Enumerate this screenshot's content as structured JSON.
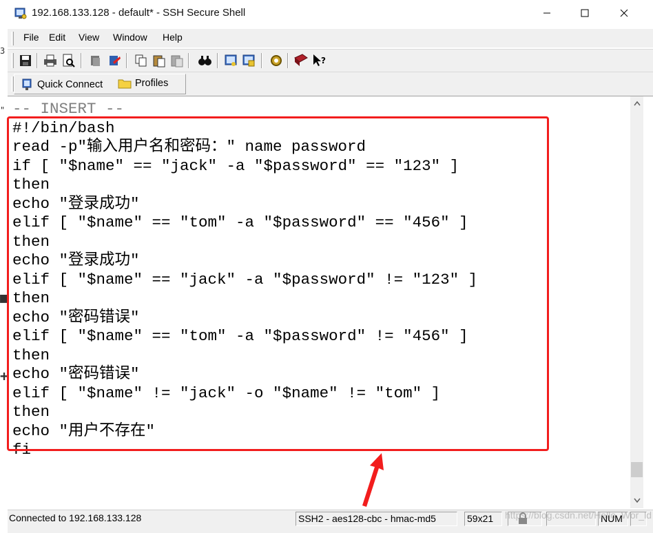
{
  "window": {
    "title": "192.168.133.128 - default* - SSH Secure Shell",
    "minimize_glyph": "—",
    "maximize_glyph": "☐",
    "close_glyph": "✕"
  },
  "menu": [
    "File",
    "Edit",
    "View",
    "Window",
    "Help"
  ],
  "quickbar": {
    "quick_connect": "Quick Connect",
    "profiles": "Profiles"
  },
  "terminal": {
    "mode_line": "-- INSERT --",
    "lines": [
      "#!/bin/bash",
      "read -p\"输入用户名和密码：\" name password",
      "if [ \"$name\" == \"jack\" -a \"$password\" == \"123\" ]",
      "then",
      "echo \"登录成功\"",
      "elif [ \"$name\" == \"tom\" -a \"$password\" == \"456\" ]",
      "then",
      "echo \"登录成功\"",
      "elif [ \"$name\" == \"jack\" -a \"$password\" != \"123\" ]",
      "then",
      "echo \"密码错误\"",
      "elif [ \"$name\" == \"tom\" -a \"$password\" != \"456\" ]",
      "then",
      "echo \"密码错误\"",
      "elif [ \"$name\" != \"jack\" -o \"$name\" != \"tom\" ]",
      "then",
      "echo \"用户不存在\"",
      "fi"
    ]
  },
  "left_strip": {
    "c1": "3",
    "c2": "\"",
    "c3": "■",
    "c4": "+"
  },
  "status": {
    "connection": "Connected to 192.168.133.128",
    "cipher": "SSH2 - aes128-cbc - hmac-md5",
    "size": "59x21",
    "num": "NUM",
    "watermark": "https://blog.csdn.net/Hello_Wor_ld"
  },
  "colors": {
    "highlight": "#f21d1d",
    "chrome": "#f0f0f0"
  }
}
